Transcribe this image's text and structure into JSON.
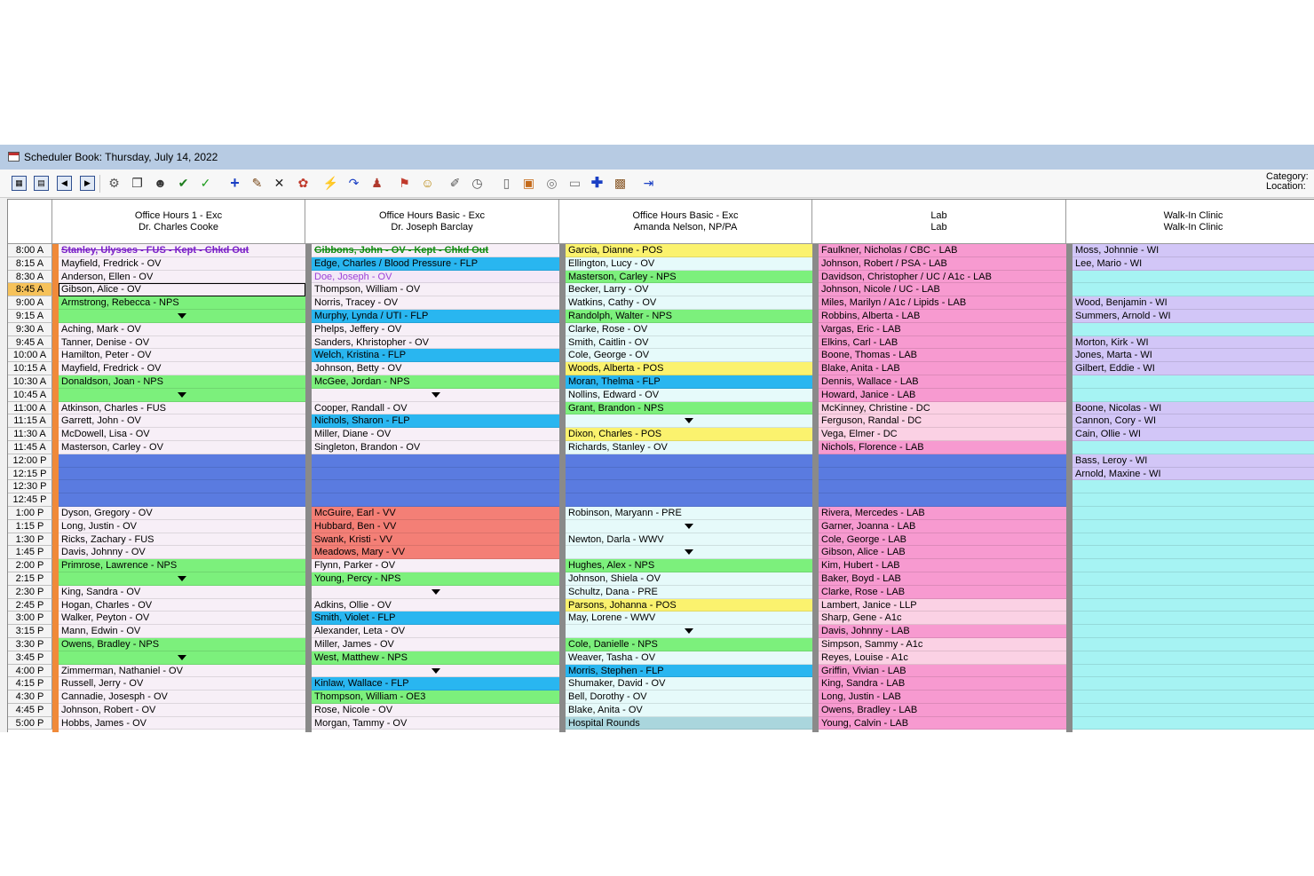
{
  "window": {
    "title": "Scheduler Book: Thursday, July 14, 2022"
  },
  "toolbar": {
    "category_label": "Category:",
    "location_label": "Location:"
  },
  "times": [
    "8:00 A",
    "8:15 A",
    "8:30 A",
    "8:45 A",
    "9:00 A",
    "9:15 A",
    "9:30 A",
    "9:45 A",
    "10:00 A",
    "10:15 A",
    "10:30 A",
    "10:45 A",
    "11:00 A",
    "11:15 A",
    "11:30 A",
    "11:45 A",
    "12:00 P",
    "12:15 P",
    "12:30 P",
    "12:45 P",
    "1:00 P",
    "1:15 P",
    "1:30 P",
    "1:45 P",
    "2:00 P",
    "2:15 P",
    "2:30 P",
    "2:45 P",
    "3:00 P",
    "3:15 P",
    "3:30 P",
    "3:45 P",
    "4:00 P",
    "4:15 P",
    "4:30 P",
    "4:45 P",
    "5:00 P"
  ],
  "current_time_index": 3,
  "colors": {
    "OV": "#f7eff7",
    "NPS": "#7cf07c",
    "FLP": "#29b6f0",
    "LUNCH": "#5a7be0",
    "VV": "#f47f76",
    "POS": "#fbf26e",
    "LAB": "#f79ad0",
    "DC": "#fbd1e4",
    "WI": "#d2c6f7",
    "EMPTY_WI": "#a6f3f3",
    "EMPTY3": "#e6fafa",
    "DOE": "#f3e8f7",
    "HOSP": "#aad6dd",
    "OE3": "#7cf07c"
  },
  "columns": [
    {
      "header": [
        "Office Hours 1 - Exc",
        "Dr. Charles Cooke"
      ],
      "sep_color": "#f08a3a",
      "slots": [
        {
          "t": "Stanley, Ulysses - FUS - Kept - Chkd Out",
          "c": "#f7eff7",
          "style": "struck-purple"
        },
        {
          "t": "Mayfield, Fredrick - OV",
          "c": "#f7eff7"
        },
        {
          "t": "Anderson, Ellen - OV",
          "c": "#f7eff7"
        },
        {
          "t": "Gibson, Alice - OV",
          "c": "#f7eff7",
          "sel": true
        },
        {
          "t": "Armstrong, Rebecca - NPS",
          "c": "#7cf07c"
        },
        {
          "t": "",
          "c": "#7cf07c",
          "arrow": true
        },
        {
          "t": "Aching, Mark - OV",
          "c": "#f7eff7"
        },
        {
          "t": "Tanner, Denise - OV",
          "c": "#f7eff7"
        },
        {
          "t": "Hamilton, Peter - OV",
          "c": "#f7eff7"
        },
        {
          "t": "Mayfield, Fredrick - OV",
          "c": "#f7eff7"
        },
        {
          "t": "Donaldson, Joan - NPS",
          "c": "#7cf07c"
        },
        {
          "t": "",
          "c": "#7cf07c",
          "arrow": true
        },
        {
          "t": "Atkinson, Charles - FUS",
          "c": "#f7eff7"
        },
        {
          "t": "Garrett, John - OV",
          "c": "#f7eff7"
        },
        {
          "t": "McDowell, Lisa - OV",
          "c": "#f7eff7"
        },
        {
          "t": "Masterson, Carley - OV",
          "c": "#f7eff7"
        },
        {
          "t": "",
          "c": "#5a7be0"
        },
        {
          "t": "",
          "c": "#5a7be0"
        },
        {
          "t": "",
          "c": "#5a7be0"
        },
        {
          "t": "",
          "c": "#5a7be0"
        },
        {
          "t": "Dyson, Gregory - OV",
          "c": "#f7eff7"
        },
        {
          "t": "Long, Justin - OV",
          "c": "#f7eff7"
        },
        {
          "t": "Ricks, Zachary - FUS",
          "c": "#f7eff7"
        },
        {
          "t": "Davis, Johnny - OV",
          "c": "#f7eff7"
        },
        {
          "t": "Primrose, Lawrence - NPS",
          "c": "#7cf07c"
        },
        {
          "t": "",
          "c": "#7cf07c",
          "arrow": true
        },
        {
          "t": "King, Sandra - OV",
          "c": "#f7eff7"
        },
        {
          "t": "Hogan, Charles - OV",
          "c": "#f7eff7"
        },
        {
          "t": "Walker, Peyton - OV",
          "c": "#f7eff7"
        },
        {
          "t": "Mann, Edwin - OV",
          "c": "#f7eff7"
        },
        {
          "t": "Owens, Bradley - NPS",
          "c": "#7cf07c"
        },
        {
          "t": "",
          "c": "#7cf07c",
          "arrow": true
        },
        {
          "t": "Zimmerman, Nathaniel - OV",
          "c": "#f7eff7"
        },
        {
          "t": "Russell, Jerry - OV",
          "c": "#f7eff7"
        },
        {
          "t": "Cannadie, Josesph - OV",
          "c": "#f7eff7"
        },
        {
          "t": "Johnson, Robert - OV",
          "c": "#f7eff7"
        },
        {
          "t": "Hobbs, James - OV",
          "c": "#f7eff7"
        }
      ]
    },
    {
      "header": [
        "Office Hours Basic - Exc",
        "Dr. Joseph Barclay"
      ],
      "sep_color": "#8a8a8a",
      "slots": [
        {
          "t": "Gibbons, John - OV - Kept - Chkd Out",
          "c": "#f7eff7",
          "style": "struck-green"
        },
        {
          "t": "Edge, Charles / Blood Pressure - FLP",
          "c": "#29b6f0"
        },
        {
          "t": "Doe, Joseph - OV",
          "c": "#f3e8f7",
          "style": "purple"
        },
        {
          "t": "Thompson, William - OV",
          "c": "#f7eff7"
        },
        {
          "t": "Norris, Tracey - OV",
          "c": "#f7eff7"
        },
        {
          "t": "Murphy, Lynda / UTI - FLP",
          "c": "#29b6f0"
        },
        {
          "t": "Phelps, Jeffery - OV",
          "c": "#f7eff7"
        },
        {
          "t": "Sanders, Khristopher - OV",
          "c": "#f7eff7"
        },
        {
          "t": "Welch, Kristina - FLP",
          "c": "#29b6f0"
        },
        {
          "t": "Johnson, Betty - OV",
          "c": "#f7eff7"
        },
        {
          "t": "McGee, Jordan - NPS",
          "c": "#7cf07c"
        },
        {
          "t": "",
          "c": "#f7eff7",
          "arrow": true
        },
        {
          "t": "Cooper, Randall - OV",
          "c": "#f7eff7"
        },
        {
          "t": "Nichols, Sharon - FLP",
          "c": "#29b6f0"
        },
        {
          "t": "Miller, Diane - OV",
          "c": "#f7eff7"
        },
        {
          "t": "Singleton, Brandon - OV",
          "c": "#f7eff7"
        },
        {
          "t": "",
          "c": "#5a7be0"
        },
        {
          "t": "",
          "c": "#5a7be0"
        },
        {
          "t": "",
          "c": "#5a7be0"
        },
        {
          "t": "",
          "c": "#5a7be0"
        },
        {
          "t": "McGuire, Earl - VV",
          "c": "#f47f76"
        },
        {
          "t": "Hubbard, Ben - VV",
          "c": "#f47f76"
        },
        {
          "t": "Swank, Kristi - VV",
          "c": "#f47f76"
        },
        {
          "t": "Meadows, Mary - VV",
          "c": "#f47f76"
        },
        {
          "t": "Flynn, Parker - OV",
          "c": "#f7eff7"
        },
        {
          "t": "Young, Percy - NPS",
          "c": "#7cf07c"
        },
        {
          "t": "",
          "c": "#f7eff7",
          "arrow": true
        },
        {
          "t": "Adkins, Ollie - OV",
          "c": "#f7eff7"
        },
        {
          "t": "Smith, Violet - FLP",
          "c": "#29b6f0"
        },
        {
          "t": "Alexander, Leta - OV",
          "c": "#f7eff7"
        },
        {
          "t": "Miller, James - OV",
          "c": "#f7eff7"
        },
        {
          "t": "West, Matthew - NPS",
          "c": "#7cf07c"
        },
        {
          "t": "",
          "c": "#f7eff7",
          "arrow": true
        },
        {
          "t": "Kinlaw, Wallace - FLP",
          "c": "#29b6f0"
        },
        {
          "t": "Thompson, William - OE3",
          "c": "#7cf07c"
        },
        {
          "t": "Rose, Nicole - OV",
          "c": "#f7eff7"
        },
        {
          "t": "Morgan, Tammy - OV",
          "c": "#f7eff7"
        }
      ]
    },
    {
      "header": [
        "Office Hours Basic - Exc",
        "Amanda Nelson, NP/PA"
      ],
      "sep_color": "#8a8a8a",
      "slots": [
        {
          "t": "Garcia, Dianne - POS",
          "c": "#fbf26e"
        },
        {
          "t": "Ellington, Lucy - OV",
          "c": "#e6fafa"
        },
        {
          "t": "Masterson, Carley - NPS",
          "c": "#7cf07c"
        },
        {
          "t": "Becker, Larry - OV",
          "c": "#e6fafa"
        },
        {
          "t": "Watkins, Cathy - OV",
          "c": "#e6fafa"
        },
        {
          "t": "Randolph, Walter - NPS",
          "c": "#7cf07c"
        },
        {
          "t": "Clarke, Rose - OV",
          "c": "#e6fafa"
        },
        {
          "t": "Smith, Caitlin - OV",
          "c": "#e6fafa"
        },
        {
          "t": "Cole, George - OV",
          "c": "#e6fafa"
        },
        {
          "t": "Woods, Alberta - POS",
          "c": "#fbf26e"
        },
        {
          "t": "Moran, Thelma - FLP",
          "c": "#29b6f0"
        },
        {
          "t": "Nollins, Edward - OV",
          "c": "#e6fafa"
        },
        {
          "t": "Grant, Brandon - NPS",
          "c": "#7cf07c"
        },
        {
          "t": "",
          "c": "#e6fafa",
          "arrow": true
        },
        {
          "t": "Dixon, Charles - POS",
          "c": "#fbf26e"
        },
        {
          "t": "Richards, Stanley - OV",
          "c": "#e6fafa"
        },
        {
          "t": "",
          "c": "#5a7be0"
        },
        {
          "t": "",
          "c": "#5a7be0"
        },
        {
          "t": "",
          "c": "#5a7be0"
        },
        {
          "t": "",
          "c": "#5a7be0"
        },
        {
          "t": "Robinson, Maryann - PRE",
          "c": "#e6fafa"
        },
        {
          "t": "",
          "c": "#e6fafa",
          "arrow": true
        },
        {
          "t": "Newton, Darla - WWV",
          "c": "#e6fafa"
        },
        {
          "t": "",
          "c": "#e6fafa",
          "arrow": true
        },
        {
          "t": "Hughes, Alex - NPS",
          "c": "#7cf07c"
        },
        {
          "t": "Johnson, Shiela - OV",
          "c": "#e6fafa"
        },
        {
          "t": "Schultz, Dana - PRE",
          "c": "#e6fafa"
        },
        {
          "t": "Parsons, Johanna - POS",
          "c": "#fbf26e"
        },
        {
          "t": "May, Lorene - WWV",
          "c": "#e6fafa"
        },
        {
          "t": "",
          "c": "#e6fafa",
          "arrow": true
        },
        {
          "t": "Cole, Danielle - NPS",
          "c": "#7cf07c"
        },
        {
          "t": "Weaver, Tasha - OV",
          "c": "#e6fafa"
        },
        {
          "t": "Morris, Stephen - FLP",
          "c": "#29b6f0"
        },
        {
          "t": "Shumaker, David - OV",
          "c": "#e6fafa"
        },
        {
          "t": "Bell, Dorothy - OV",
          "c": "#e6fafa"
        },
        {
          "t": "Blake, Anita - OV",
          "c": "#e6fafa"
        },
        {
          "t": "Hospital Rounds",
          "c": "#aad6dd"
        }
      ]
    },
    {
      "header": [
        "Lab",
        "Lab"
      ],
      "sep_color": "#8a8a8a",
      "slots": [
        {
          "t": "Faulkner, Nicholas / CBC - LAB",
          "c": "#f79ad0"
        },
        {
          "t": "Johnson, Robert / PSA - LAB",
          "c": "#f79ad0"
        },
        {
          "t": "Davidson, Christopher / UC / A1c - LAB",
          "c": "#f79ad0"
        },
        {
          "t": "Johnson, Nicole / UC - LAB",
          "c": "#f79ad0"
        },
        {
          "t": "Miles, Marilyn / A1c / Lipids - LAB",
          "c": "#f79ad0"
        },
        {
          "t": "Robbins, Alberta - LAB",
          "c": "#f79ad0"
        },
        {
          "t": "Vargas, Eric - LAB",
          "c": "#f79ad0"
        },
        {
          "t": "Elkins, Carl - LAB",
          "c": "#f79ad0"
        },
        {
          "t": "Boone, Thomas - LAB",
          "c": "#f79ad0"
        },
        {
          "t": "Blake, Anita - LAB",
          "c": "#f79ad0"
        },
        {
          "t": "Dennis, Wallace - LAB",
          "c": "#f79ad0"
        },
        {
          "t": "Howard, Janice - LAB",
          "c": "#f79ad0"
        },
        {
          "t": "McKinney, Christine - DC",
          "c": "#fbd1e4"
        },
        {
          "t": "Ferguson, Randal - DC",
          "c": "#fbd1e4"
        },
        {
          "t": "Vega, Elmer - DC",
          "c": "#fbd1e4"
        },
        {
          "t": "Nichols, Florence - LAB",
          "c": "#f79ad0"
        },
        {
          "t": "",
          "c": "#5a7be0"
        },
        {
          "t": "",
          "c": "#5a7be0"
        },
        {
          "t": "",
          "c": "#5a7be0"
        },
        {
          "t": "",
          "c": "#5a7be0"
        },
        {
          "t": "Rivera, Mercedes - LAB",
          "c": "#f79ad0"
        },
        {
          "t": "Garner, Joanna - LAB",
          "c": "#f79ad0"
        },
        {
          "t": "Cole, George - LAB",
          "c": "#f79ad0"
        },
        {
          "t": "Gibson, Alice - LAB",
          "c": "#f79ad0"
        },
        {
          "t": "Kim, Hubert - LAB",
          "c": "#f79ad0"
        },
        {
          "t": "Baker, Boyd - LAB",
          "c": "#f79ad0"
        },
        {
          "t": "Clarke, Rose - LAB",
          "c": "#f79ad0"
        },
        {
          "t": "Lambert, Janice - LLP",
          "c": "#fbd1e4"
        },
        {
          "t": "Sharp, Gene - A1c",
          "c": "#fbd1e4"
        },
        {
          "t": "Davis, Johnny - LAB",
          "c": "#f79ad0"
        },
        {
          "t": "Simpson, Sammy - A1c",
          "c": "#fbd1e4"
        },
        {
          "t": "Reyes, Louise - A1c",
          "c": "#fbd1e4"
        },
        {
          "t": "Griffin, Vivian - LAB",
          "c": "#f79ad0"
        },
        {
          "t": "King, Sandra - LAB",
          "c": "#f79ad0"
        },
        {
          "t": "Long, Justin - LAB",
          "c": "#f79ad0"
        },
        {
          "t": "Owens, Bradley - LAB",
          "c": "#f79ad0"
        },
        {
          "t": "Young, Calvin - LAB",
          "c": "#f79ad0"
        }
      ]
    },
    {
      "header": [
        "Walk-In Clinic",
        "Walk-In Clinic"
      ],
      "sep_color": "#8a8a8a",
      "slots": [
        {
          "t": "Moss, Johnnie - WI",
          "c": "#d2c6f7"
        },
        {
          "t": "Lee, Mario - WI",
          "c": "#d2c6f7"
        },
        {
          "t": "",
          "c": "#a6f3f3"
        },
        {
          "t": "",
          "c": "#a6f3f3"
        },
        {
          "t": "Wood, Benjamin - WI",
          "c": "#d2c6f7"
        },
        {
          "t": "Summers, Arnold - WI",
          "c": "#d2c6f7"
        },
        {
          "t": "",
          "c": "#a6f3f3"
        },
        {
          "t": "Morton, Kirk - WI",
          "c": "#d2c6f7"
        },
        {
          "t": "Jones, Marta - WI",
          "c": "#d2c6f7"
        },
        {
          "t": "Gilbert, Eddie - WI",
          "c": "#d2c6f7"
        },
        {
          "t": "",
          "c": "#a6f3f3"
        },
        {
          "t": "",
          "c": "#a6f3f3"
        },
        {
          "t": "Boone, Nicolas - WI",
          "c": "#d2c6f7"
        },
        {
          "t": "Cannon, Cory - WI",
          "c": "#d2c6f7"
        },
        {
          "t": "Cain, Ollie - WI",
          "c": "#d2c6f7"
        },
        {
          "t": "",
          "c": "#a6f3f3"
        },
        {
          "t": "Bass, Leroy - WI",
          "c": "#d2c6f7"
        },
        {
          "t": "Arnold, Maxine - WI",
          "c": "#d2c6f7"
        },
        {
          "t": "",
          "c": "#a6f3f3"
        },
        {
          "t": "",
          "c": "#a6f3f3"
        },
        {
          "t": "",
          "c": "#a6f3f3"
        },
        {
          "t": "",
          "c": "#a6f3f3"
        },
        {
          "t": "",
          "c": "#a6f3f3"
        },
        {
          "t": "",
          "c": "#a6f3f3"
        },
        {
          "t": "",
          "c": "#a6f3f3"
        },
        {
          "t": "",
          "c": "#a6f3f3"
        },
        {
          "t": "",
          "c": "#a6f3f3"
        },
        {
          "t": "",
          "c": "#a6f3f3"
        },
        {
          "t": "",
          "c": "#a6f3f3"
        },
        {
          "t": "",
          "c": "#a6f3f3"
        },
        {
          "t": "",
          "c": "#a6f3f3"
        },
        {
          "t": "",
          "c": "#a6f3f3"
        },
        {
          "t": "",
          "c": "#a6f3f3"
        },
        {
          "t": "",
          "c": "#a6f3f3"
        },
        {
          "t": "",
          "c": "#a6f3f3"
        },
        {
          "t": "",
          "c": "#a6f3f3"
        },
        {
          "t": "",
          "c": "#a6f3f3"
        }
      ]
    }
  ],
  "toolbar_icons": [
    "day-view-icon",
    "week-view-icon",
    "prev-day-icon",
    "next-day-icon",
    "find-icon",
    "copy-icon",
    "patient-icon",
    "check-in-icon",
    "check-out-icon",
    "add-appointment-icon",
    "edit-appointment-icon",
    "delete-icon",
    "reschedule-icon",
    "quick-icon",
    "recall-icon",
    "provider-icon",
    "flag-icon",
    "person-icon",
    "pen-icon",
    "search-clock-icon",
    "note-icon",
    "book-icon",
    "globe-icon",
    "window-icon",
    "medical-icon",
    "calendar-icon",
    "exit-icon"
  ]
}
